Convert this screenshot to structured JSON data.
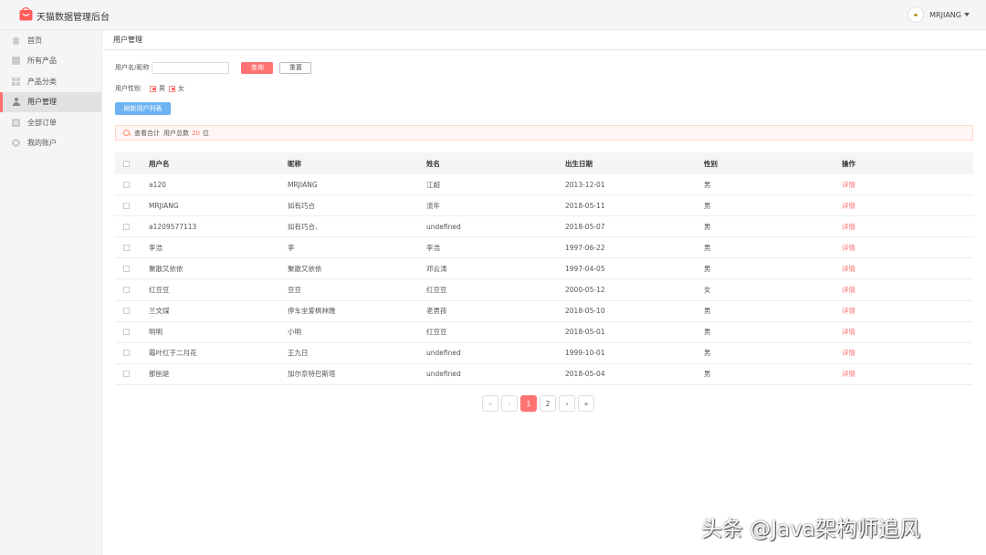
{
  "header": {
    "brand": "天猫数据管理后台",
    "username": "MRJIANG",
    "accent": "#ff6e6e"
  },
  "sidebar": {
    "items": [
      {
        "label": "首页",
        "icon": "home-icon"
      },
      {
        "label": "所有产品",
        "icon": "product-icon"
      },
      {
        "label": "产品分类",
        "icon": "grid-icon"
      },
      {
        "label": "用户管理",
        "icon": "user-icon",
        "active": true
      },
      {
        "label": "全部订单",
        "icon": "order-icon"
      },
      {
        "label": "我的账户",
        "icon": "gear-icon"
      }
    ]
  },
  "main": {
    "title": "用户管理",
    "filter": {
      "name_label": "用户名/昵称",
      "name_value": "",
      "query_label": "查询",
      "reset_label": "重置",
      "gender_label": "用户性别",
      "male_label": "男",
      "female_label": "女",
      "male_checked": true,
      "female_checked": true
    },
    "refresh_label": "刷新用户列表",
    "notice": {
      "prefix": "查看合计",
      "total_label": "用户总数",
      "count": "20",
      "unit": "位"
    },
    "table": {
      "headers": [
        "用户名",
        "昵称",
        "姓名",
        "出生日期",
        "性别",
        "操作"
      ],
      "rows": [
        [
          "a120",
          "MRJIANG",
          "江超",
          "2013-12-01",
          "男",
          "详情"
        ],
        [
          "MRJIANG",
          "如有巧合",
          "流年",
          "2018-05-11",
          "男",
          "详情"
        ],
        [
          "a1209577113",
          "如有巧合、",
          "undefined",
          "2018-05-07",
          "男",
          "详情"
        ],
        [
          "李浩",
          "李",
          "李浩",
          "1997-06-22",
          "男",
          "详情"
        ],
        [
          "聚散又依依",
          "聚散又依依",
          "邓云涛",
          "1997-04-05",
          "男",
          "详情"
        ],
        [
          "红豆豆",
          "豆豆",
          "红豆豆",
          "2000-05-12",
          "女",
          "详情"
        ],
        [
          "兰文煤",
          "停车坐爱枫林晚",
          "老男孩",
          "2018-05-10",
          "男",
          "详情"
        ],
        [
          "明明",
          "小明",
          "红豆豆",
          "2018-05-01",
          "男",
          "详情"
        ],
        [
          "霜叶红于二月花",
          "王九日",
          "undefined",
          "1999-10-01",
          "男",
          "详情"
        ],
        [
          "那刨是",
          "加尔奈特巴斯塔",
          "undefined",
          "2018-05-04",
          "男",
          "详情"
        ]
      ]
    },
    "pagination": {
      "first": "«",
      "prev": "‹",
      "pages": [
        "1",
        "2"
      ],
      "current": "1",
      "next": "›",
      "last": "»"
    }
  },
  "watermark": "头条 @Java架构师追风"
}
